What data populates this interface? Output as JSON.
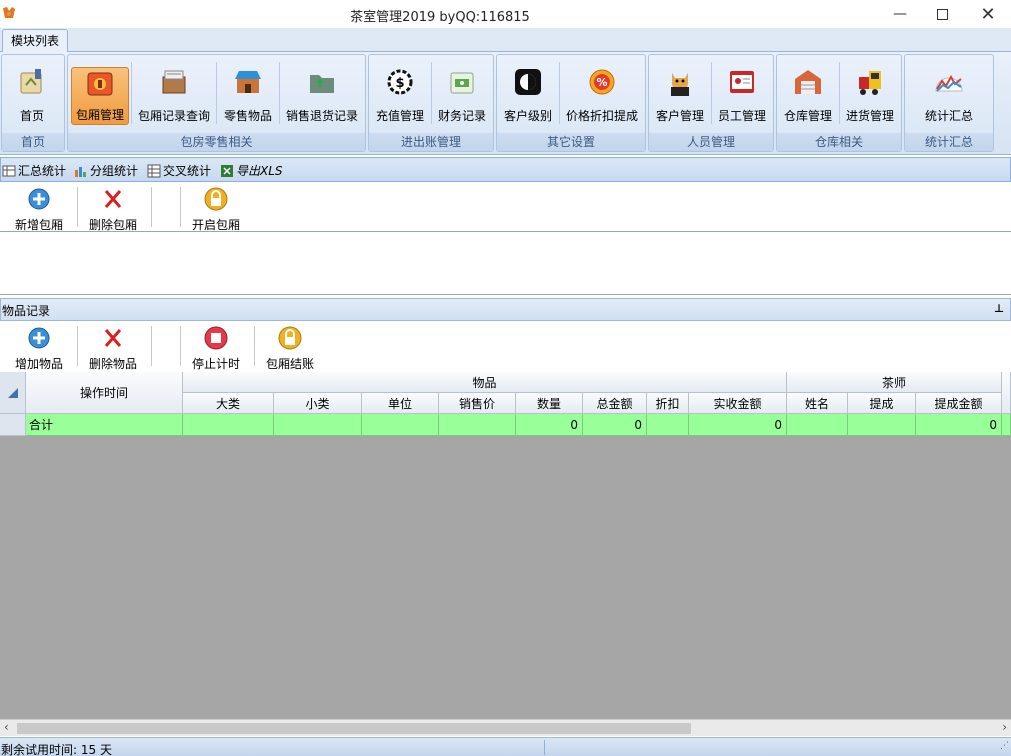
{
  "window": {
    "title": "茶室管理2019 byQQ:116815"
  },
  "ribbon_tab": "模块列表",
  "ribbon": {
    "groups": [
      {
        "caption": "首页"
      },
      {
        "caption": "包房零售相关"
      },
      {
        "caption": "进出账管理"
      },
      {
        "caption": "其它设置"
      },
      {
        "caption": "人员管理"
      },
      {
        "caption": "仓库相关"
      },
      {
        "caption": "统计汇总"
      }
    ],
    "buttons": {
      "home": "首页",
      "room_manage": "包厢管理",
      "room_query": "包厢记录查询",
      "retail": "零售物品",
      "returns": "销售退货记录",
      "recharge": "充值管理",
      "finance": "财务记录",
      "cust_level": "客户级别",
      "discount": "价格折扣提成",
      "customer": "客户管理",
      "employee": "员工管理",
      "warehouse": "仓库管理",
      "purchase": "进货管理",
      "stats": "统计汇总"
    }
  },
  "subbar": {
    "summary": "汇总统计",
    "group": "分组统计",
    "cross": "交叉统计",
    "export": "导出XLS"
  },
  "room_toolbar": {
    "add": "新增包厢",
    "delete": "删除包厢",
    "open": "开启包厢"
  },
  "items_panel": {
    "title": "物品记录",
    "pin": "⊥"
  },
  "items_toolbar": {
    "add": "增加物品",
    "delete": "删除物品",
    "stop": "停止计时",
    "checkout": "包厢结账"
  },
  "grid": {
    "op_time": "操作时间",
    "band_items": "物品",
    "band_tea": "茶师",
    "cols": [
      "大类",
      "小类",
      "单位",
      "销售价",
      "数量",
      "总金额",
      "折扣",
      "实收金额",
      "姓名",
      "提成",
      "提成金额"
    ],
    "summary_label": "合计",
    "summary": {
      "qty": "0",
      "total": "0",
      "received": "0",
      "commission": "0"
    }
  },
  "status": {
    "trial": "剩余试用时间: 15 天"
  },
  "colors": {
    "accent": "#f19b3d",
    "summary_row": "#99ff99",
    "grid_bg": "#a6a6a6"
  }
}
